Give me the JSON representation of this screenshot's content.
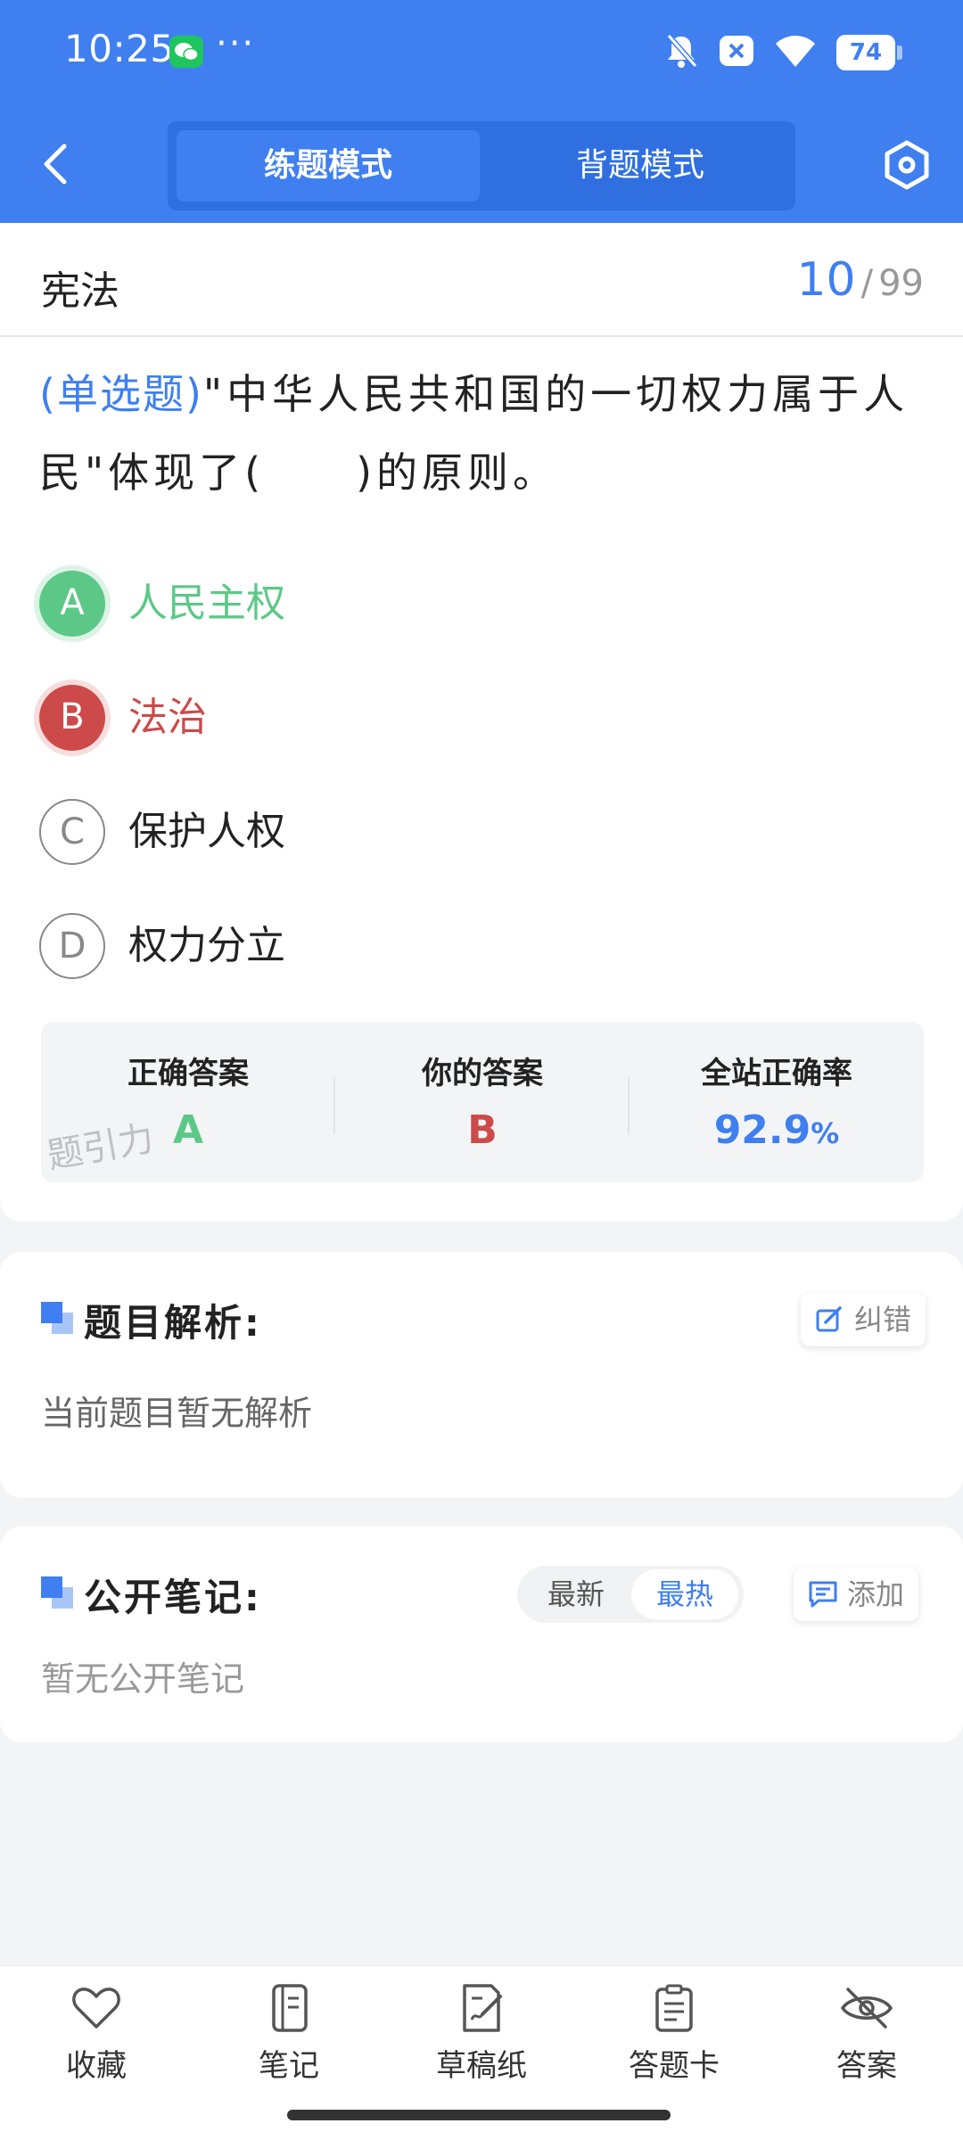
{
  "status_bar": {
    "time": "10:25",
    "more": "···",
    "battery": "74",
    "icons": [
      "wechat-icon",
      "bell-off-icon",
      "notification-x-icon",
      "wifi-icon",
      "battery-icon"
    ]
  },
  "header": {
    "back_icon": "chevron-left-icon",
    "tabs": [
      {
        "label": "练题模式",
        "active": true
      },
      {
        "label": "背题模式",
        "active": false
      }
    ],
    "settings_icon": "hexagon-settings-icon"
  },
  "question": {
    "subject": "宪法",
    "current": "10",
    "separator": "/",
    "total": "99",
    "type": "(单选题)",
    "text": "\"中华人民共和国的一切权力属于人民\"体现了(　　)的原则。",
    "options": [
      {
        "key": "A",
        "text": "人民主权",
        "state": "correct"
      },
      {
        "key": "B",
        "text": "法治",
        "state": "wrong"
      },
      {
        "key": "C",
        "text": "保护人权",
        "state": "none"
      },
      {
        "key": "D",
        "text": "权力分立",
        "state": "none"
      }
    ]
  },
  "answer_summary": {
    "correct_label": "正确答案",
    "correct_value": "A",
    "yours_label": "你的答案",
    "yours_value": "B",
    "rate_label": "全站正确率",
    "rate_value": "92.9",
    "rate_unit": "%",
    "watermark": "题引力"
  },
  "analysis": {
    "title": "题目解析:",
    "report_label": "纠错",
    "body": "当前题目暂无解析"
  },
  "notes": {
    "title": "公开笔记:",
    "sort_options": [
      {
        "label": "最新",
        "active": false
      },
      {
        "label": "最热",
        "active": true
      }
    ],
    "add_label": "添加",
    "body": "暂无公开笔记"
  },
  "bottom_nav": [
    {
      "label": "收藏",
      "icon": "heart-icon"
    },
    {
      "label": "笔记",
      "icon": "notebook-icon"
    },
    {
      "label": "草稿纸",
      "icon": "draft-paper-icon"
    },
    {
      "label": "答题卡",
      "icon": "answer-sheet-icon"
    },
    {
      "label": "答案",
      "icon": "eye-off-icon"
    }
  ],
  "colors": {
    "primary": "#3f7ff0",
    "correct": "#5cc887",
    "wrong": "#cc4a4a",
    "background": "#f3f4f6"
  }
}
